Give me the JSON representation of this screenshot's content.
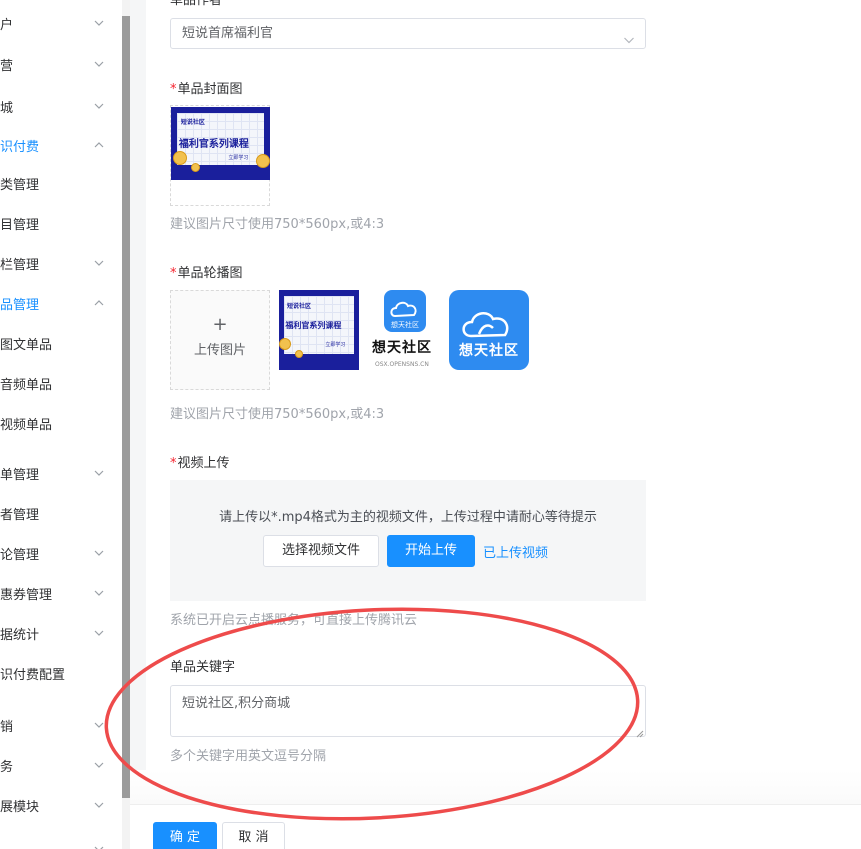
{
  "sidebar": {
    "items": [
      {
        "label": "户",
        "arrow": "down"
      },
      {
        "label": "营",
        "arrow": "down"
      },
      {
        "label": "城",
        "arrow": "down"
      },
      {
        "label": "识付费",
        "arrow": "up",
        "active": true
      },
      {
        "label": "类管理"
      },
      {
        "label": "目管理"
      },
      {
        "label": "栏管理",
        "arrow": "down"
      },
      {
        "label": "品管理",
        "arrow": "up",
        "active": true
      },
      {
        "label": "图文单品"
      },
      {
        "label": "音频单品"
      },
      {
        "label": "视频单品"
      },
      {
        "label": "单管理",
        "arrow": "down"
      },
      {
        "label": "者管理"
      },
      {
        "label": "论管理",
        "arrow": "down"
      },
      {
        "label": "惠券管理",
        "arrow": "down"
      },
      {
        "label": "据统计",
        "arrow": "down"
      },
      {
        "label": "识付费配置"
      },
      {
        "label": "销",
        "arrow": "down"
      },
      {
        "label": "务",
        "arrow": "down"
      },
      {
        "label": "展模块",
        "arrow": "down"
      },
      {
        "label": "",
        "arrow": "down"
      }
    ]
  },
  "form": {
    "author_label_partial": "单品作者",
    "author_value": "短说首席福利官",
    "cover_label": "单品封面图",
    "cover_hint": "建议图片尺寸使用750*560px,或4:3",
    "carousel_label": "单品轮播图",
    "upload_plus": "+",
    "upload_text": "上传图片",
    "carousel_hint": "建议图片尺寸使用750*560px,或4:3",
    "video_label": "视频上传",
    "video_tip": "请上传以*.mp4格式为主的视频文件，上传过程中请耐心等待提示",
    "select_video_button": "选择视频文件",
    "start_upload_button": "开始上传",
    "uploaded_link": "已上传视频",
    "video_hint": "系统已开启云点播服务，可直接上传腾讯云",
    "keywords_label": "单品关键字",
    "keywords_value": "短说社区,积分商城",
    "keywords_hint": "多个关键字用英文逗号分隔",
    "required_mark": "*"
  },
  "images": {
    "poster_small": "福利官系列课程",
    "poster_tag": "短说社区",
    "poster_sub": "立即学习",
    "logo_name": "想天社区",
    "logo_domain": "OSX.OPENSNS.CN"
  },
  "footer": {
    "confirm_button": "确 定",
    "cancel_button": "取 消"
  },
  "colors": {
    "primary": "#1890ff",
    "annotation": "#ee4b4b",
    "poster_blue": "#1a1f9c",
    "logo_blue": "#2e8bf0"
  }
}
